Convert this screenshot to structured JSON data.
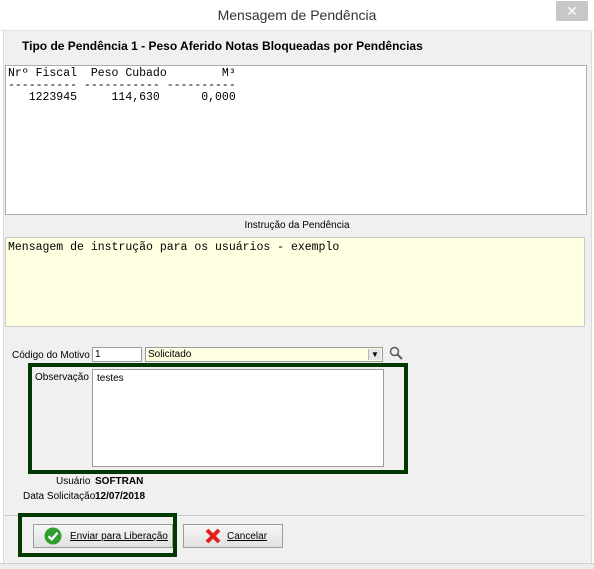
{
  "window": {
    "title": "Mensagem de Pendência",
    "close_glyph": "✕"
  },
  "heading": "Tipo de Pendência 1   - Peso Aferido  Notas Bloqueadas por Pendências",
  "table_text": {
    "header": "Nrº Fiscal  Peso Cubado        M³",
    "separator": "---------- ----------- ----------",
    "row1": "   1223945     114,630      0,000"
  },
  "instruction": {
    "label": "Instrução da Pendência",
    "text": "Mensagem de instrução para os usuários - exemplo"
  },
  "form": {
    "motivo_label": "Código do Motivo",
    "motivo_code": "1",
    "motivo_selected": "Solicitado",
    "observacao_label": "Observação",
    "observacao_text": "testes",
    "usuario_label": "Usuário",
    "usuario_value": "SOFTRAN",
    "data_label": "Data Solicitação",
    "data_value": "12/07/2018"
  },
  "buttons": {
    "enviar": "Enviar para Liberação",
    "cancelar": "Cancelar"
  },
  "colors": {
    "highlight_frame": "#003800",
    "instruction_bg": "#ffffe1"
  },
  "icons": {
    "enviar": "check-circle-icon",
    "cancelar": "red-x-icon",
    "search": "magnifier-icon"
  }
}
